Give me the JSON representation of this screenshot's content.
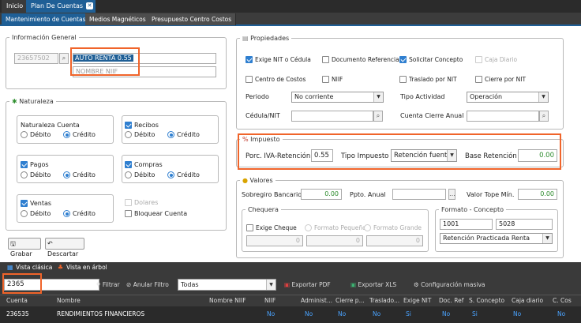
{
  "tabs": {
    "inicio": "Inicio",
    "plan": "Plan De Cuentas"
  },
  "subtabs": [
    "Mantenimiento de Cuentas",
    "Medios Magnéticos",
    "Presupuesto Centro Costos"
  ],
  "info": {
    "legend": "Información General",
    "code": "23657502",
    "name": "AUTO RENTA 0.55",
    "niif_placeholder": "NOMBRE NIIF"
  },
  "naturaleza": {
    "legend": "Naturaleza",
    "cuenta_label": "Naturaleza Cuenta",
    "debito": "Débito",
    "credito": "Crédito",
    "recibos": "Recibos",
    "pagos": "Pagos",
    "compras": "Compras",
    "ventas": "Ventas",
    "dolares": "Dolares",
    "bloquear": "Bloquear Cuenta"
  },
  "buttons": {
    "grabar": "Grabar",
    "descartar": "Descartar"
  },
  "propiedades": {
    "legend": "Propiedades",
    "exige_nit": "Exige NIT o Cédula",
    "doc_ref": "Documento Referencia",
    "solicitar": "Solicitar Concepto",
    "caja": "Caja Diario",
    "centro": "Centro de Costos",
    "niif": "NIIF",
    "traslado": "Traslado por NIT",
    "cierre": "Cierre por NIT",
    "periodo_label": "Periodo",
    "periodo_value": "No corriente",
    "tipo_label": "Tipo Actividad",
    "tipo_value": "Operación",
    "cedula_label": "Cédula/NIT",
    "cuenta_cierre_label": "Cuenta Cierre Anual"
  },
  "impuesto": {
    "legend": "Impuesto",
    "porc_label": "Porc. IVA-Retención",
    "porc_value": "0.55",
    "tipo_label": "Tipo Impuesto",
    "tipo_value": "Retención fuente",
    "base_label": "Base Retención",
    "base_value": "0.00"
  },
  "valores": {
    "legend": "Valores",
    "sobregiro_label": "Sobregiro Bancario",
    "sobregiro_value": "0.00",
    "ppto_label": "Ppto. Anual",
    "tope_label": "Valor Tope Mín.",
    "tope_value": "0.00",
    "chequera_legend": "Chequera",
    "exige_cheque": "Exige Cheque",
    "pequeno": "Formato Pequeño",
    "grande": "Formato Grande",
    "zero": "0",
    "formato_legend": "Formato - Concepto",
    "f1": "1001",
    "f2": "5028",
    "concepto": "Retención Practicada Renta"
  },
  "bottom": {
    "vista_clasica": "Vista clásica",
    "vista_arbol": "Vista en árbol",
    "search_value": "2365",
    "filtrar": "Filtrar",
    "anular": "Anular Filtro",
    "todas": "Todas",
    "pdf": "Exportar PDF",
    "xls": "Exportar XLS",
    "config": "Configuración masiva",
    "headers": [
      "Cuenta",
      "Nombre",
      "Nombre NIIF",
      "NIIF",
      "Administ...",
      "Cierre p...",
      "Traslado...",
      "Exige NIT",
      "Doc. Ref",
      "S. Concepto",
      "Caja diario",
      "C. Cos"
    ],
    "row": [
      "236535",
      "RENDIMIENTOS FINANCIEROS",
      "",
      "No",
      "No",
      "No",
      "No",
      "Si",
      "No",
      "Si",
      "No",
      "No"
    ]
  },
  "colors": {
    "accent": "#1f5f96",
    "highlight": "#f0642a",
    "link": "#4aa3ff"
  }
}
